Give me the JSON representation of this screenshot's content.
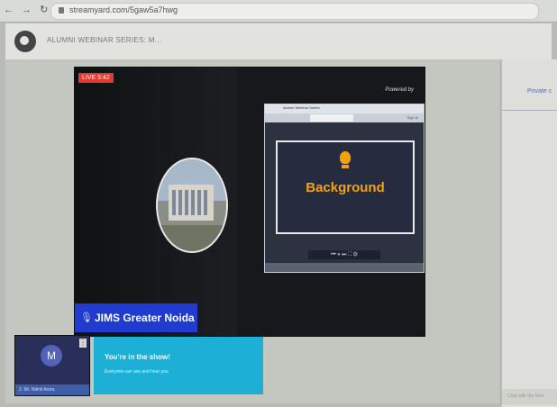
{
  "browser": {
    "url": "streamyard.com/5gaw5a7hwg"
  },
  "header": {
    "title": "ALUMNI WEBINAR SERIES: M..."
  },
  "stage": {
    "live_label": "LIVE 5:42",
    "powered_by": "Powered by",
    "name_banner": "JIMS Greater Noida",
    "shared_slide": {
      "window_title": "Alumni Webinar Series",
      "signin": "Sign In",
      "title": "Background",
      "controls": "⏮ ⏸ ⏭ ⛶ ⚙"
    }
  },
  "participant": {
    "initial": "M",
    "name": "2. Mr. Nikhil Arora"
  },
  "notice": {
    "title": "You're in the show!",
    "subtitle": "Everyone can see and hear you"
  },
  "sidebar": {
    "tab": "Private c",
    "chat_placeholder": "Chat with the host"
  },
  "colors": {
    "live": "#e63a2e",
    "banner": "#1f3bd0",
    "notice": "#1cb0d7",
    "accent": "#f2a20f"
  }
}
